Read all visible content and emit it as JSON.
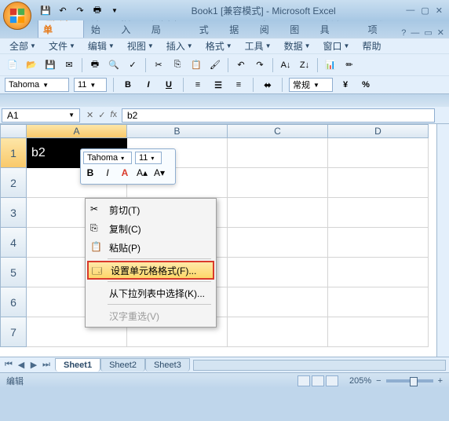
{
  "title": "Book1  [兼容模式] - Microsoft Excel",
  "qat": {
    "save": "💾"
  },
  "tabs": [
    "经典菜单",
    "开始",
    "插入",
    "页面布局",
    "公式",
    "数据",
    "审阅",
    "视图",
    "开发工具",
    "加载项"
  ],
  "active_tab": 0,
  "menus": {
    "all": "全部",
    "file": "文件",
    "edit": "编辑",
    "view": "视图",
    "insert": "插入",
    "format": "格式",
    "tools": "工具",
    "data": "数据",
    "window": "窗口",
    "help": "帮助"
  },
  "font": {
    "name": "Tahoma",
    "size": "11"
  },
  "style_label": "常规",
  "namebox": "A1",
  "formula": "b2",
  "columns": [
    "A",
    "B",
    "C",
    "D"
  ],
  "rows": [
    "1",
    "2",
    "3",
    "4",
    "5",
    "6",
    "7"
  ],
  "cell_value": "b2",
  "mini": {
    "font": "Tahoma",
    "size": "11"
  },
  "ctx": {
    "cut": "剪切(T)",
    "copy": "复制(C)",
    "paste": "粘贴(P)",
    "format": "设置单元格格式(F)...",
    "pick": "从下拉列表中选择(K)...",
    "ime": "汉字重选(V)"
  },
  "sheets": [
    "Sheet1",
    "Sheet2",
    "Sheet3"
  ],
  "status": "编辑",
  "zoom": "205%"
}
